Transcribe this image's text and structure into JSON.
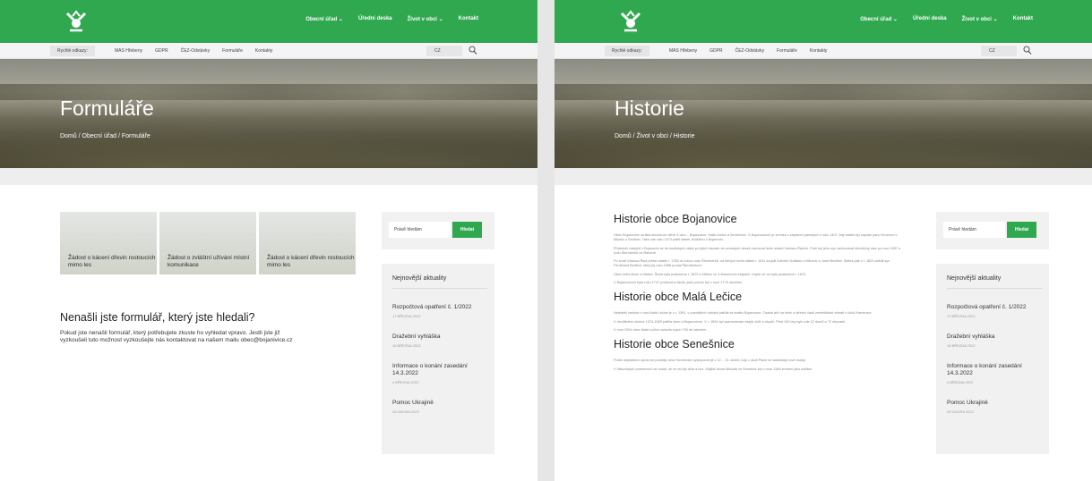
{
  "nav": [
    "Obecní úřad ⌄",
    "Úřední deska",
    "Život v obci ⌄",
    "Kontakt"
  ],
  "quick_label": "Rychlé odkazy:",
  "quick_links": [
    "MAS Hřebeny",
    "GDPR",
    "ČEZ-Odstávky",
    "Formuláře",
    "Kontakty"
  ],
  "lang": "CZ",
  "sidebar": {
    "search_placeholder": "Právě hledám",
    "search_button": "Hledat",
    "news_title": "Nejnovější aktuality",
    "news": [
      {
        "title": "Rozpočtová opatření č. 1/2022",
        "date": "17 BŘEZNA 2022"
      },
      {
        "title": "Dražební vyhláška",
        "date": "16 BŘEZNA 2022"
      },
      {
        "title": "Informace o konání zasedání 14.3.2022",
        "date": "4 BŘEZNA 2022"
      },
      {
        "title": "Pomoc Ukrajině",
        "date": "28 ÚNORA 2022"
      }
    ]
  },
  "left": {
    "hero_title": "Formuláře",
    "breadcrumb": "Domů / Obecní úřad / Formuláře",
    "cards": [
      "Žádost o kácení dřevin rostoucích mimo les",
      "Žádost o zvláštní užívání místní komunikace",
      "Žádost o kácení dřevin rostoucích mimo les"
    ],
    "question": "Nenašli jste formulář, který jste hledali?",
    "question_text": "Pokud jste nenašli formulář, který potřebujete zkuste ho vyhledat vpravo. Jestli jste již vyzkoušeli tuto možnost vyzkoušejte nás kontaktovat na našem mailu obec@bojanivice.cz"
  },
  "right": {
    "hero_title": "Historie",
    "breadcrumb": "Domů / Život v obci / Historie",
    "sections": [
      {
        "title": "Historie obce Bojanovice",
        "paras": [
          "Obec Bojanovice vznikla sloučením dříve 3 obcí – Bojanovice, Malá Lečice a Senešnice. O Bojanovicích je zmínka v zápisech pánských z roku 1407, kdy statek byl zapsán panu Hrochovi v Mlýnku z Sedlčan. Také zde roku 1473 patřil statek Jindřichu z Bojanovic.",
          "Přídomek vladyků z Bojanovic se do husitských válek po jejich návratu do zemských desek zachoval tento statek Václavu Řáďovi. Poté byl jeho syn zachovával šlechtický stav po roce 1657 u rodu Šternberků na Rábeně.",
          "Po smrti Václava Řádi přešel statek r. 1785 do rukou rodu Šternberků, od kterých tento statek r. 1811 koupili Zdeněk Vratislav z Mitrovic a Josef Bedřich. Statek pak v r. 1823 zdědil syn Ferdinand Bedřich, který jej roku 1858 prodal Šternberkovi.",
          "Obec měla školu a hřbitov. Škola byla postavena r. 1875 a hřbitov ve 4 stavebních etapách. Kaple ve vsi byla postavena r. 1872.",
          "V Bojanovicích byla roku 1747 postavena škola, jejíž provoz byl v roce 1778 ukončen."
        ]
      },
      {
        "title": "Historie obce Malá Lečice",
        "paras": [
          "Nejstarší zmínka o obci Malá Lečice je z r. 1391, v pozdějších dobách patřila ke statku Bojanovice. Osada leží na dolní a střední části zemědělské oblasti v údolí Kamenice.",
          "V devítiletém období 1574-1583 patřila obec k Bojanovicím. V r. 1654 byl zaznamenán zdejší dvůr a obydlí. Před 100 lety bylo zde 12 domů a 72 obyvatel.",
          "V roce 2004 obec Malá Lečice oslavila svých 700 let založení."
        ]
      },
      {
        "title": "Historie obce Senešnice",
        "paras": [
          "Podle nejstarších zpráv lze počátky obce Senešnice vystopovat již v 12. - 13. století, kdy v okolí Plané se zakládaly nové osady.",
          "V historických pramenech se uvádí, že ve vsi byl dvůr a tvrz. Majitel dvora Mikuláš ze Senešnic byl v roce 1348 zmíněn jako svědek."
        ]
      }
    ]
  },
  "colors": {
    "brand_green": "#2fa84f"
  }
}
